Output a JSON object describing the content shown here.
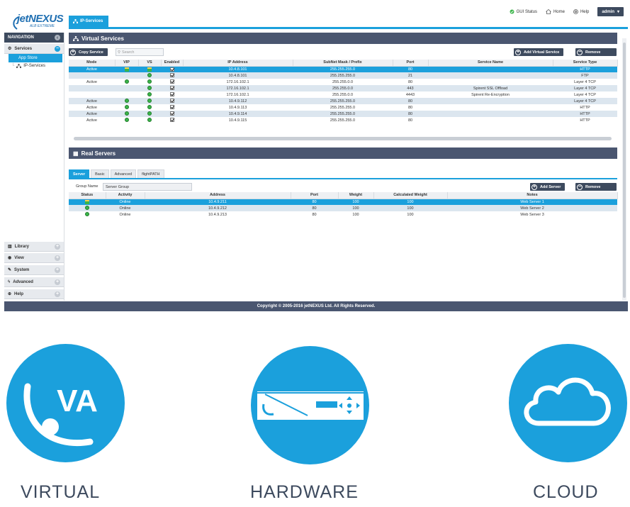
{
  "header": {
    "logo_text": "jetNEXUS",
    "logo_sub": "ALB EXTREME",
    "active_tab": "IP-Services",
    "links": [
      {
        "label": "GUI Status",
        "icon": "check-circle-icon"
      },
      {
        "label": "Home",
        "icon": "home-icon"
      },
      {
        "label": "Help",
        "icon": "lifebuoy-icon"
      }
    ],
    "user": "admin"
  },
  "sidebar": {
    "title": "NAVIGATION",
    "services_label": "Services",
    "active_item": "App Store",
    "tree_item": "IP-Services",
    "sections": [
      {
        "label": "Library",
        "icon": "library-icon"
      },
      {
        "label": "View",
        "icon": "eye-icon"
      },
      {
        "label": "System",
        "icon": "wrench-icon"
      },
      {
        "label": "Advanced",
        "icon": "bolt-icon"
      },
      {
        "label": "Help",
        "icon": "lifebuoy-icon"
      }
    ]
  },
  "virtual_services": {
    "title": "Virtual Services",
    "copy_button": "Copy Service",
    "search_placeholder": "Search",
    "add_button": "Add Virtual Service",
    "remove_button": "Remove",
    "columns": [
      "Mode",
      "VIP",
      "VS",
      "Enabled",
      "IP Address",
      "SubNet Mask / Prefix",
      "Port",
      "Service Name",
      "Service Type"
    ],
    "rows": [
      {
        "mode": "Active",
        "vip": "vip",
        "vs": "vip",
        "enabled": true,
        "ip": "10.4.8.101",
        "mask": "255.255.255.0",
        "port": "80",
        "name": "",
        "type": "HTTP",
        "state": "sel"
      },
      {
        "mode": "",
        "vip": "",
        "vs": "dot",
        "enabled": true,
        "ip": "10.4.8.101",
        "mask": "255.255.255.0",
        "port": "21",
        "name": "",
        "type": "FTP",
        "state": "alt"
      },
      {
        "mode": "Active",
        "vip": "dot",
        "vs": "dot",
        "enabled": true,
        "ip": "172.16.102.1",
        "mask": "255.255.0.0",
        "port": "80",
        "name": "",
        "type": "Layer 4 TCP",
        "state": ""
      },
      {
        "mode": "",
        "vip": "",
        "vs": "dot",
        "enabled": true,
        "ip": "172.16.102.1",
        "mask": "255.255.0.0",
        "port": "443",
        "name": "Spirent SSL Offload",
        "type": "Layer 4 TCP",
        "state": "alt"
      },
      {
        "mode": "",
        "vip": "",
        "vs": "dot",
        "enabled": true,
        "ip": "172.16.102.1",
        "mask": "255.255.0.0",
        "port": "4443",
        "name": "Spirent Re-Encryption",
        "type": "Layer 4 TCP",
        "state": ""
      },
      {
        "mode": "Active",
        "vip": "dot",
        "vs": "dot",
        "enabled": true,
        "ip": "10.4.9.112",
        "mask": "255.255.255.0",
        "port": "80",
        "name": "",
        "type": "Layer 4 TCP",
        "state": "alt"
      },
      {
        "mode": "Active",
        "vip": "dot",
        "vs": "dot",
        "enabled": true,
        "ip": "10.4.9.113",
        "mask": "255.255.255.0",
        "port": "80",
        "name": "",
        "type": "HTTP",
        "state": ""
      },
      {
        "mode": "Active",
        "vip": "dot",
        "vs": "dot",
        "enabled": true,
        "ip": "10.4.9.114",
        "mask": "255.255.255.0",
        "port": "80",
        "name": "",
        "type": "HTTP",
        "state": "alt"
      },
      {
        "mode": "Active",
        "vip": "dot",
        "vs": "dot",
        "enabled": true,
        "ip": "10.4.9.115",
        "mask": "255.255.255.0",
        "port": "80",
        "name": "",
        "type": "HTTP",
        "state": ""
      }
    ]
  },
  "real_servers": {
    "title": "Real Servers",
    "tabs": [
      "Server",
      "Basic",
      "Advanced",
      "flightPATH"
    ],
    "group_label": "Group Name",
    "group_value": "Server Group",
    "add_button": "Add Server",
    "remove_button": "Remove",
    "columns": [
      "Status",
      "Activity",
      "Address",
      "Port",
      "Weight",
      "Calculated Weight",
      "Notes"
    ],
    "rows": [
      {
        "status": "vip",
        "activity": "Online",
        "address": "10.4.9.211",
        "port": "80",
        "weight": "100",
        "calc": "100",
        "notes": "Web Server 1",
        "state": "sel"
      },
      {
        "status": "dot",
        "activity": "Online",
        "address": "10.4.9.212",
        "port": "80",
        "weight": "100",
        "calc": "100",
        "notes": "Web Server 2",
        "state": "alt"
      },
      {
        "status": "dot",
        "activity": "Online",
        "address": "10.4.9.213",
        "port": "80",
        "weight": "100",
        "calc": "100",
        "notes": "Web Server 3",
        "state": ""
      }
    ]
  },
  "footer": "Copyright © 2005-2016 jetNEXUS Ltd. All Rights Reserved.",
  "promo": {
    "va_text": "VA",
    "labels": [
      "VIRTUAL",
      "HARDWARE",
      "CLOUD"
    ],
    "accent": "#1ba0dc",
    "label_color": "#3d4a5e"
  }
}
